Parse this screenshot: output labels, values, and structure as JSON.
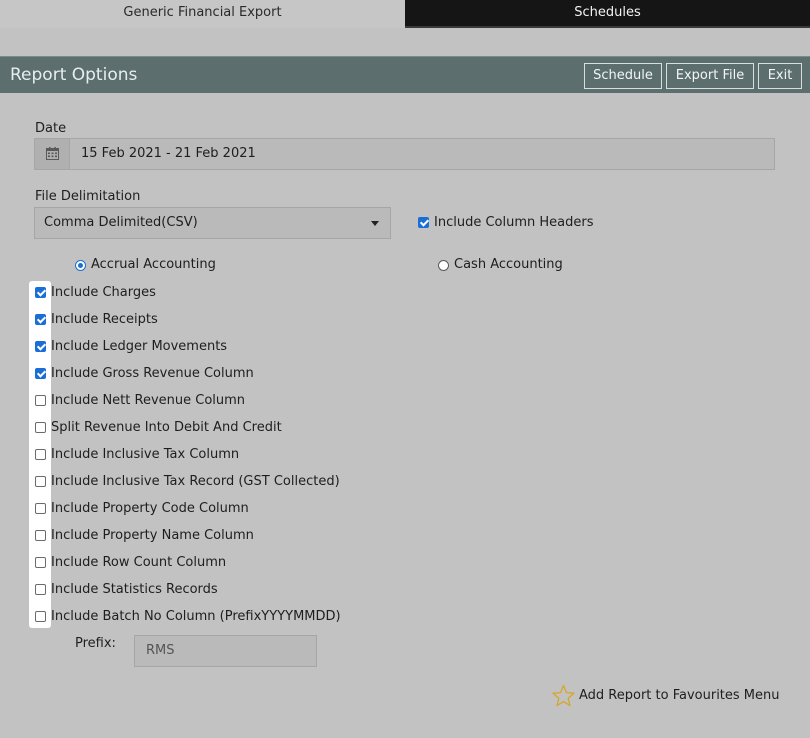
{
  "tabs": [
    {
      "label": "Generic Financial Export",
      "active": true
    },
    {
      "label": "Schedules",
      "active": false
    }
  ],
  "header": {
    "title": "Report Options",
    "buttons": {
      "schedule": "Schedule",
      "export_file": "Export File",
      "exit": "Exit"
    }
  },
  "date": {
    "label": "Date",
    "value": "15 Feb 2021 - 21 Feb 2021",
    "icon": "calendar-icon"
  },
  "delimitation": {
    "label": "File Delimitation",
    "value": "Comma Delimited(CSV)"
  },
  "include_column_headers": {
    "label": "Include Column Headers",
    "checked": true
  },
  "accounting": {
    "accrual": {
      "label": "Accrual Accounting",
      "selected": true
    },
    "cash": {
      "label": "Cash Accounting",
      "selected": false
    }
  },
  "options": [
    {
      "label": "Include Charges",
      "checked": true
    },
    {
      "label": "Include Receipts",
      "checked": true
    },
    {
      "label": "Include Ledger Movements",
      "checked": true
    },
    {
      "label": "Include Gross Revenue Column",
      "checked": true
    },
    {
      "label": "Include Nett Revenue Column",
      "checked": false
    },
    {
      "label": "Split Revenue Into Debit And Credit",
      "checked": false
    },
    {
      "label": "Include Inclusive Tax Column",
      "checked": false
    },
    {
      "label": "Include Inclusive Tax Record (GST Collected)",
      "checked": false
    },
    {
      "label": "Include Property Code Column",
      "checked": false
    },
    {
      "label": "Include Property Name Column",
      "checked": false
    },
    {
      "label": "Include Row Count Column",
      "checked": false
    },
    {
      "label": "Include Statistics Records",
      "checked": false
    },
    {
      "label": "Include Batch No Column (PrefixYYYYMMDD)",
      "checked": false
    }
  ],
  "prefix": {
    "label": "Prefix:",
    "value": "RMS"
  },
  "favourites": {
    "label": "Add Report to Favourites Menu",
    "icon": "star-icon"
  },
  "colors": {
    "header_bg": "#5c6e6e",
    "page_bg": "#c2c2c2",
    "checkbox_accent": "#1a6fd6",
    "star": "#d4a82a"
  }
}
